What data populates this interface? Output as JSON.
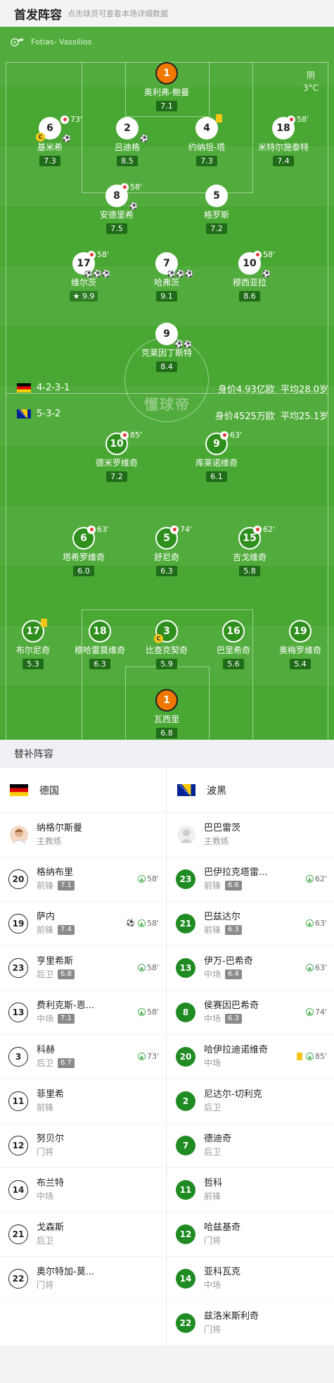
{
  "header": {
    "title": "首发阵容",
    "hint": "点击球员可查看本场详细数据"
  },
  "pitch": {
    "referee": "Fotias- Vassilios",
    "weather": "阴",
    "temperature": "3°C",
    "watermark": "懂球帝",
    "home": {
      "formation": "4-2-3-1",
      "value": "身价4.93亿欧",
      "avg_age": "平均28.0岁"
    },
    "away": {
      "formation": "5-3-2",
      "value": "身价4525万欧",
      "avg_age": "平均25.1岁"
    }
  },
  "home_players": [
    {
      "num": "1",
      "name": "奥利弗-鲍曼",
      "rating": "7.1"
    },
    {
      "num": "6",
      "name": "基米希",
      "rating": "7.3",
      "sub": "73'"
    },
    {
      "num": "2",
      "name": "吕迪格",
      "rating": "8.5"
    },
    {
      "num": "4",
      "name": "约纳坦-塔",
      "rating": "7.3"
    },
    {
      "num": "18",
      "name": "米特尔施泰特",
      "rating": "7.4",
      "sub": "58'"
    },
    {
      "num": "8",
      "name": "安德里希",
      "rating": "7.5",
      "sub": "58'"
    },
    {
      "num": "5",
      "name": "格罗斯",
      "rating": "7.2"
    },
    {
      "num": "17",
      "name": "维尔茨",
      "rating": "9.9",
      "sub": "58'"
    },
    {
      "num": "7",
      "name": "哈弗茨",
      "rating": "9.1"
    },
    {
      "num": "10",
      "name": "穆西亚拉",
      "rating": "8.6",
      "sub": "58'"
    },
    {
      "num": "9",
      "name": "克莱因丁斯特",
      "rating": "8.4"
    }
  ],
  "away_players": [
    {
      "num": "10",
      "name": "德米罗维奇",
      "rating": "7.2",
      "sub": "85'"
    },
    {
      "num": "9",
      "name": "库莱诺维奇",
      "rating": "6.1",
      "sub": "63'"
    },
    {
      "num": "6",
      "name": "塔希罗维奇",
      "rating": "6.0",
      "sub": "63'"
    },
    {
      "num": "5",
      "name": "舒尼奇",
      "rating": "6.3",
      "sub": "74'"
    },
    {
      "num": "15",
      "name": "吉戈维奇",
      "rating": "5.8",
      "sub": "62'"
    },
    {
      "num": "17",
      "name": "布尔尼奇",
      "rating": "5.3"
    },
    {
      "num": "18",
      "name": "穆哈雷莫维奇",
      "rating": "6.3"
    },
    {
      "num": "3",
      "name": "比查克契奇",
      "rating": "5.9"
    },
    {
      "num": "16",
      "name": "巴里希奇",
      "rating": "5.6"
    },
    {
      "num": "19",
      "name": "奥梅罗维奇",
      "rating": "5.4"
    },
    {
      "num": "1",
      "name": "瓦西里",
      "rating": "6.8"
    }
  ],
  "bench": {
    "title": "替补阵容",
    "home": {
      "team": "德国",
      "coach": {
        "name": "纳格尔斯曼",
        "role": "主教练"
      },
      "players": [
        {
          "num": "20",
          "name": "格纳布里",
          "pos": "前锋",
          "rating": "7.1",
          "min": "58'"
        },
        {
          "num": "19",
          "name": "萨内",
          "pos": "前锋",
          "rating": "7.4",
          "min": "58'"
        },
        {
          "num": "23",
          "name": "亨里希斯",
          "pos": "后卫",
          "rating": "6.8",
          "min": "58'"
        },
        {
          "num": "13",
          "name": "费利克斯-恩...",
          "pos": "中场",
          "rating": "7.1",
          "min": "58'"
        },
        {
          "num": "3",
          "name": "科赫",
          "pos": "后卫",
          "rating": "6.7",
          "min": "73'"
        },
        {
          "num": "11",
          "name": "菲里希",
          "pos": "前锋"
        },
        {
          "num": "12",
          "name": "努贝尔",
          "pos": "门将"
        },
        {
          "num": "14",
          "name": "布兰特",
          "pos": "中场"
        },
        {
          "num": "21",
          "name": "戈森斯",
          "pos": "后卫"
        },
        {
          "num": "22",
          "name": "奥尔特加-莫...",
          "pos": "门将"
        }
      ]
    },
    "away": {
      "team": "波黑",
      "coach": {
        "name": "巴巴雷茨",
        "role": "主教练"
      },
      "players": [
        {
          "num": "23",
          "name": "巴伊拉克塔雷...",
          "pos": "前锋",
          "rating": "6.6",
          "min": "62'"
        },
        {
          "num": "21",
          "name": "巴兹达尔",
          "pos": "前锋",
          "rating": "6.3",
          "min": "63'"
        },
        {
          "num": "13",
          "name": "伊万-巴希奇",
          "pos": "中场",
          "rating": "6.4",
          "min": "63'"
        },
        {
          "num": "8",
          "name": "侯赛因巴希奇",
          "pos": "中场",
          "rating": "6.3",
          "min": "74'"
        },
        {
          "num": "20",
          "name": "哈伊拉迪诺维奇",
          "pos": "中场",
          "min": "85'"
        },
        {
          "num": "2",
          "name": "尼达尔-切利克",
          "pos": "后卫"
        },
        {
          "num": "7",
          "name": "德迪奇",
          "pos": "后卫"
        },
        {
          "num": "11",
          "name": "哲科",
          "pos": "前锋"
        },
        {
          "num": "12",
          "name": "哈兹基奇",
          "pos": "门将"
        },
        {
          "num": "14",
          "name": "亚科瓦克",
          "pos": "中场"
        },
        {
          "num": "22",
          "name": "兹洛米斯利奇",
          "pos": "门将"
        }
      ]
    }
  }
}
